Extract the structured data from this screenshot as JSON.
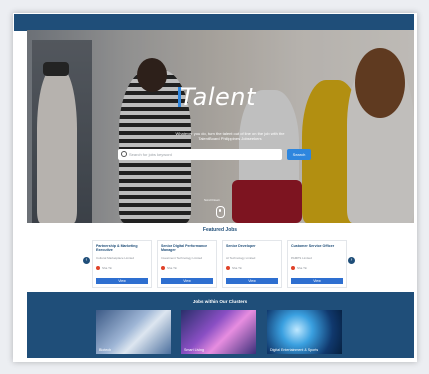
{
  "hero": {
    "logo_text": "Talent",
    "tagline": "Whatever you do, turn the talent out of line on the job with the TalentBoard Philippines Jobseekers",
    "search_placeholder": "Search for jobs keyword",
    "search_button": "Search",
    "scroll_label": "Scroll Down"
  },
  "featured": {
    "title": "Featured Jobs",
    "prev_icon": "‹",
    "next_icon": "›",
    "cards": [
      {
        "title": "Partnership & Marketing Executive",
        "company": "Cultural Marketplace Limited",
        "location": "Sha Tin",
        "action": "View"
      },
      {
        "title": "Senior Digital Performance Manager",
        "company": "Investment Technology Limited",
        "location": "Sha Tin",
        "action": "View"
      },
      {
        "title": "Senior Developer",
        "company": "AI Technology Limited",
        "location": "Sha Tin",
        "action": "View"
      },
      {
        "title": "Customer Service Officer",
        "company": "PAMPS Limited",
        "location": "Sha Tin",
        "action": "View"
      }
    ]
  },
  "clusters": {
    "title": "Jobs within Our Clusters",
    "tiles": [
      {
        "label": "Biotech"
      },
      {
        "label": "Smart Living"
      },
      {
        "label": "Digital Entertainment & Sports"
      }
    ]
  },
  "colors": {
    "brand_navy": "#1f4e79",
    "accent_blue": "#2e86de",
    "view_button": "#2e6fd0"
  }
}
